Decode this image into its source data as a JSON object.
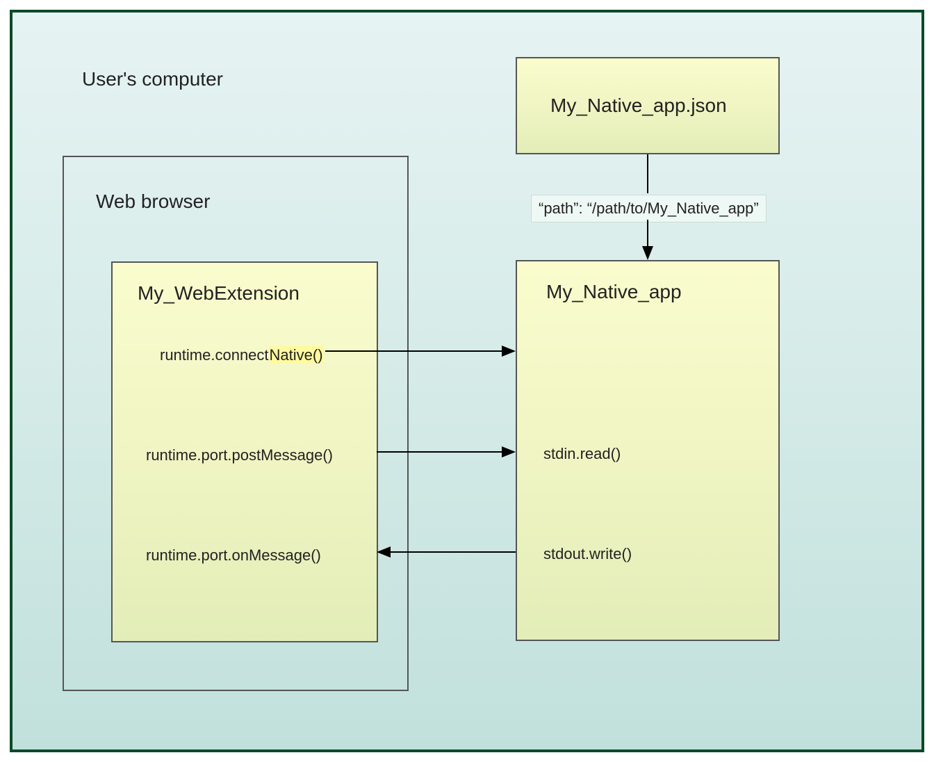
{
  "containers": {
    "computer": "User's computer",
    "browser": "Web browser"
  },
  "boxes": {
    "webextension": {
      "title": "My_WebExtension",
      "api1_prefix": "runtime.connect",
      "api1_highlight": "Native()",
      "api2": "runtime.port.postMessage()",
      "api3": "runtime.port.onMessage()"
    },
    "manifest": {
      "title": "My_Native_app.json"
    },
    "nativeapp": {
      "title": "My_Native_app",
      "api1": "stdin.read()",
      "api2": "stdout.write()"
    }
  },
  "connector": {
    "path_label": "“path”: “/path/to/My_Native_app”"
  }
}
